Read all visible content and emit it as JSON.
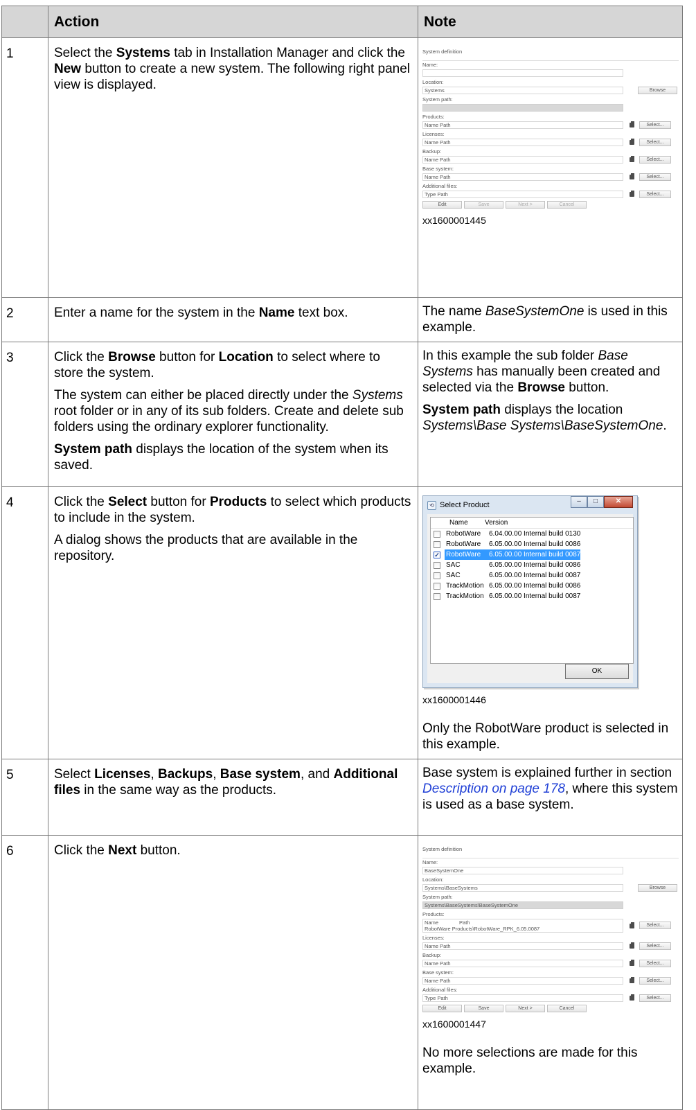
{
  "table": {
    "headers": [
      "",
      "Action",
      "Note"
    ],
    "rows": [
      {
        "num": "1",
        "action_runs": [
          [
            {
              "t": "Select the "
            },
            {
              "t": "Systems",
              "b": true
            },
            {
              "t": " tab in Installation Manager and click the "
            },
            {
              "t": "New",
              "b": true
            },
            {
              "t": " button to create a new system. The following right panel view is displayed."
            }
          ]
        ],
        "figure": {
          "type": "panel",
          "caption": "xx1600001445",
          "panel": {
            "header": "System definition",
            "name_label": "Name:",
            "name_value": "",
            "location_label": "Location:",
            "location_value": "Systems",
            "browse_label": "Browse",
            "system_path_label": "System path:",
            "system_path_value": "",
            "products_label": "Products:",
            "products_value": "Name Path",
            "licenses_label": "Licenses:",
            "licenses_value": "Name Path",
            "backup_label": "Backup:",
            "backup_value": "Name Path",
            "base_system_label": "Base system:",
            "base_system_value": "Name Path",
            "additional_files_label": "Additional files:",
            "additional_files_value": "Type Path",
            "select_label": "Select...",
            "edit_label": "Edit",
            "save_label": "Save",
            "next_label": "Next   >",
            "cancel_label": "Cancel"
          }
        }
      },
      {
        "num": "2",
        "action_runs": [
          [
            {
              "t": "Enter a name for the system in the "
            },
            {
              "t": "Name",
              "b": true
            },
            {
              "t": " text box."
            }
          ]
        ],
        "note_runs": [
          [
            {
              "t": "The name "
            },
            {
              "t": "BaseSystemOne",
              "i": true
            },
            {
              "t": " is used in this example."
            }
          ]
        ]
      },
      {
        "num": "3",
        "action_runs": [
          [
            {
              "t": "Click the "
            },
            {
              "t": "Browse",
              "b": true
            },
            {
              "t": " button for "
            },
            {
              "t": "Location",
              "b": true
            },
            {
              "t": " to select where to store the system."
            }
          ],
          [
            {
              "t": "The system can either be placed directly under the "
            },
            {
              "t": "Systems",
              "i": true
            },
            {
              "t": " root folder or in any of its sub folders. Create and delete sub folders using the ordinary explorer functionality."
            }
          ],
          [
            {
              "t": "System path",
              "b": true
            },
            {
              "t": " displays the location of the system when its saved."
            }
          ]
        ],
        "note_runs": [
          [
            {
              "t": "In this example the sub folder "
            },
            {
              "t": "Base Systems",
              "i": true
            },
            {
              "t": " has manually been created and selected via the "
            },
            {
              "t": "Browse",
              "b": true
            },
            {
              "t": " button."
            }
          ],
          [
            {
              "t": "System path",
              "b": true
            },
            {
              "t": " displays the location "
            },
            {
              "t": "Systems\\Base Systems\\BaseSystemOne",
              "i": true
            },
            {
              "t": "."
            }
          ]
        ]
      },
      {
        "num": "4",
        "action_runs": [
          [
            {
              "t": "Click the "
            },
            {
              "t": "Select",
              "b": true
            },
            {
              "t": " button for "
            },
            {
              "t": "Products",
              "b": true
            },
            {
              "t": " to select which products to include in the system."
            }
          ],
          [
            {
              "t": "A dialog shows the products that are available in the repository."
            }
          ]
        ],
        "figure": {
          "type": "dialog",
          "caption": "xx1600001446",
          "dialog": {
            "title": "Select Product",
            "col_name": "Name",
            "col_version": "Version",
            "ok_label": "OK",
            "items": [
              {
                "name": "RobotWare",
                "version": "6.04.00.00 Internal build 0130",
                "checked": false,
                "selected": false
              },
              {
                "name": "RobotWare",
                "version": "6.05.00.00 Internal build 0086",
                "checked": false,
                "selected": false
              },
              {
                "name": "RobotWare",
                "version": "6.05.00.00 Internal build 0087",
                "checked": true,
                "selected": true
              },
              {
                "name": "SAC",
                "version": "6.05.00.00 Internal build 0086",
                "checked": false,
                "selected": false
              },
              {
                "name": "SAC",
                "version": "6.05.00.00 Internal build 0087",
                "checked": false,
                "selected": false
              },
              {
                "name": "TrackMotion",
                "version": "6.05.00.00 Internal build 0086",
                "checked": false,
                "selected": false
              },
              {
                "name": "TrackMotion",
                "version": "6.05.00.00 Internal build 0087",
                "checked": false,
                "selected": false
              }
            ]
          }
        },
        "note_after_runs": [
          [
            {
              "t": "Only the RobotWare product is selected in this example."
            }
          ]
        ]
      },
      {
        "num": "5",
        "action_runs": [
          [
            {
              "t": "Select "
            },
            {
              "t": "Licenses",
              "b": true
            },
            {
              "t": ", "
            },
            {
              "t": "Backups",
              "b": true
            },
            {
              "t": ", "
            },
            {
              "t": "Base system",
              "b": true
            },
            {
              "t": ", and "
            },
            {
              "t": "Additional files",
              "b": true
            },
            {
              "t": " in the same way as the products."
            }
          ]
        ],
        "note_runs": [
          [
            {
              "t": "Base system is explained further in section "
            },
            {
              "t": "Description on page 178",
              "link": true
            },
            {
              "t": ", where this system is used as a base system."
            }
          ]
        ]
      },
      {
        "num": "6",
        "action_runs": [
          [
            {
              "t": "Click the "
            },
            {
              "t": "Next",
              "b": true
            },
            {
              "t": " button."
            }
          ]
        ],
        "figure": {
          "type": "panel",
          "caption": "xx1600001447",
          "panel": {
            "header": "System definition",
            "name_label": "Name:",
            "name_value": "BaseSystemOne",
            "location_label": "Location:",
            "location_value": "Systems\\BaseSystems",
            "browse_label": "Browse",
            "system_path_label": "System path:",
            "system_path_value": "Systems\\BaseSystems\\BaseSystemOne",
            "products_label": "Products:",
            "products_header_name": "Name",
            "products_header_path": "Path",
            "products_value": "RobotWare   Products\\RobotWare_RPK_6.05.0087",
            "licenses_label": "Licenses:",
            "licenses_value": "Name Path",
            "backup_label": "Backup:",
            "backup_value": "Name Path",
            "base_system_label": "Base system:",
            "base_system_value": "Name Path",
            "additional_files_label": "Additional files:",
            "additional_files_value": "Type Path",
            "select_label": "Select...",
            "edit_label": "Edit",
            "save_label": "Save",
            "next_label": "Next   >",
            "cancel_label": "Cancel"
          }
        },
        "note_after_runs": [
          [
            {
              "t": "No more selections are made for this example."
            }
          ]
        ]
      }
    ]
  }
}
